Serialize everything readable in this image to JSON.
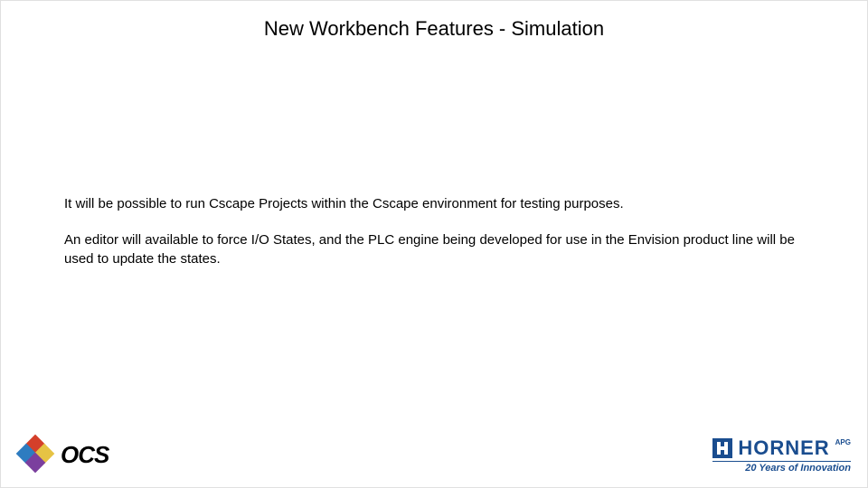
{
  "title": "New Workbench Features - Simulation",
  "body": {
    "p1": "It will be possible to run Cscape Projects within the Cscape environment for testing purposes.",
    "p2": "An editor will available to force I/O States, and the PLC engine being developed for use in the Envision product line will be used to update the states."
  },
  "footer": {
    "left_logo_text": "OCS",
    "right_logo_text": "HORNER",
    "right_logo_suffix": "APG",
    "right_tagline": "20 Years of Innovation"
  }
}
